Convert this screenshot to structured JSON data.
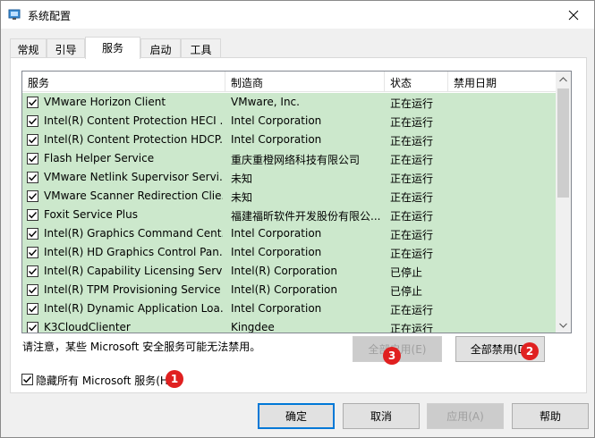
{
  "window": {
    "title": "系统配置"
  },
  "tabs": [
    {
      "label": "常规"
    },
    {
      "label": "引导"
    },
    {
      "label": "服务"
    },
    {
      "label": "启动"
    },
    {
      "label": "工具"
    }
  ],
  "list": {
    "columns": [
      "服务",
      "制造商",
      "状态",
      "禁用日期"
    ],
    "rows": [
      {
        "service": "VMware Horizon Client",
        "maker": "VMware, Inc.",
        "status": "正在运行",
        "checked": true
      },
      {
        "service": "Intel(R) Content Protection HECI ...",
        "maker": "Intel Corporation",
        "status": "正在运行",
        "checked": true
      },
      {
        "service": "Intel(R) Content Protection HDCP...",
        "maker": "Intel Corporation",
        "status": "正在运行",
        "checked": true
      },
      {
        "service": "Flash Helper Service",
        "maker": "重庆重橙网络科技有限公司",
        "status": "正在运行",
        "checked": true
      },
      {
        "service": "VMware Netlink Supervisor Servi...",
        "maker": "未知",
        "status": "正在运行",
        "checked": true
      },
      {
        "service": "VMware Scanner Redirection Clie...",
        "maker": "未知",
        "status": "正在运行",
        "checked": true
      },
      {
        "service": "Foxit Service Plus",
        "maker": "福建福昕软件开发股份有限公...",
        "status": "正在运行",
        "checked": true
      },
      {
        "service": "Intel(R) Graphics Command Cent...",
        "maker": "Intel Corporation",
        "status": "正在运行",
        "checked": true
      },
      {
        "service": "Intel(R) HD Graphics Control Pan...",
        "maker": "Intel Corporation",
        "status": "正在运行",
        "checked": true
      },
      {
        "service": "Intel(R) Capability Licensing Servi...",
        "maker": "Intel(R) Corporation",
        "status": "已停止",
        "checked": true
      },
      {
        "service": "Intel(R) TPM Provisioning Service",
        "maker": "Intel(R) Corporation",
        "status": "已停止",
        "checked": true
      },
      {
        "service": "Intel(R) Dynamic Application Loa...",
        "maker": "Intel Corporation",
        "status": "正在运行",
        "checked": true
      },
      {
        "service": "K3CloudClienter",
        "maker": "Kingdee",
        "status": "正在运行",
        "checked": true
      }
    ]
  },
  "note": "请注意，某些 Microsoft 安全服务可能无法禁用。",
  "buttons": {
    "enable_all": "全部启用(E)",
    "disable_all": "全部禁用(D)",
    "ok": "确定",
    "cancel": "取消",
    "apply": "应用(A)",
    "help": "帮助"
  },
  "hide_ms": {
    "label": "隐藏所有 Microsoft 服务(H)",
    "checked": true
  },
  "badges": {
    "b1": "1",
    "b2": "2",
    "b3": "3"
  },
  "colors": {
    "row_bg": "#cce8cc",
    "badge": "#e02020",
    "default_border": "#0078d7"
  }
}
